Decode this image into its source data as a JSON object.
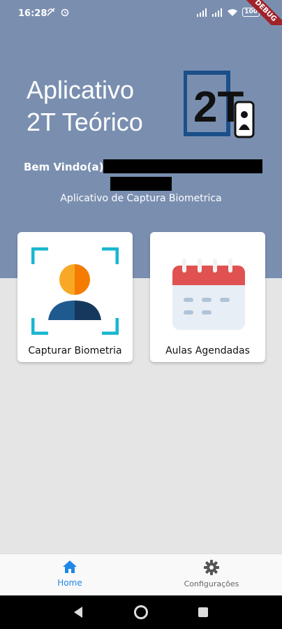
{
  "status_bar": {
    "time": "16:28",
    "battery": "100",
    "debug_label": "DEBUG"
  },
  "header": {
    "title_line1": "Aplicativo",
    "title_line2": "2T Teórico",
    "logo_text": "2T",
    "welcome": "Bem Vindo(a)",
    "subtitle": "Aplicativo de Captura Biometrica"
  },
  "cards": {
    "biometria": {
      "label": "Capturar Biometria"
    },
    "aulas": {
      "label": "Aulas Agendadas"
    }
  },
  "bottom_nav": {
    "home_label": "Home",
    "config_label": "Configurações"
  },
  "colors": {
    "header_bg": "#7a8fb0",
    "active_tab": "#1e88e5",
    "calendar_red": "#e05252"
  }
}
